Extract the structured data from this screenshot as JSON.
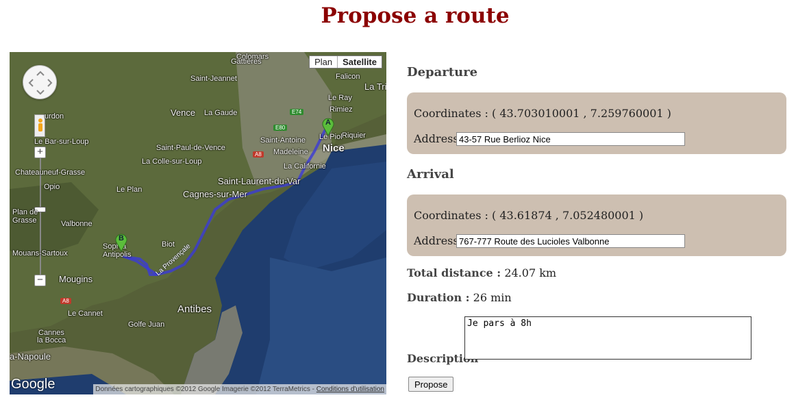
{
  "page": {
    "title": "Propose a route"
  },
  "map": {
    "type_buttons": {
      "plan": "Plan",
      "satellite": "Satellite",
      "selected": "Satellite"
    },
    "places": {
      "colomars": "Colomars",
      "gattieres": "Gattières",
      "saint_jeannet": "Saint-Jeannet",
      "falicon": "Falicon",
      "la_trinite": "La Tri",
      "le_ray": "Le Ray",
      "rimiez": "Rimiez",
      "tourrettes": "urdon",
      "vence": "Vence",
      "la_gaude": "La Gaude",
      "le_bar": "Le Bar-sur-Loup",
      "saint_paul": "Saint-Paul-de-Vence",
      "la_colle": "La Colle-sur-Loup",
      "saint_antoine": "Saint-Antoine",
      "madeleine": "Madeleine",
      "le_piol": "Le Piol",
      "riquier": "Riquier",
      "nice": "Nice",
      "la_californie": "La Californie",
      "chateauneuf": "Chateauneuf-Grasse",
      "opio": "Opio",
      "le_plan": "Le Plan",
      "saint_laurent": "Saint-Laurent-du-Var",
      "cagnes": "Cagnes-sur-Mer",
      "plan_de_grasse": "Plan de Grasse",
      "valbonne": "Valbonne",
      "biot": "Biot",
      "sophia": "Sophia Antipolis",
      "mouans": "Mouans-Sartoux",
      "mougins": "Mougins",
      "le_cannet": "Le Cannet",
      "antibes": "Antibes",
      "golfe_juan": "Golfe Juan",
      "cannes": "Cannes",
      "la_bocca": "la Bocca",
      "la_napoule": "a-Napoule",
      "route_name": "La Provençale"
    },
    "roads": {
      "a8": "A8",
      "e74": "E74",
      "e80": "E80"
    },
    "markers": {
      "start": "A",
      "end": "B"
    },
    "logo": "Google",
    "attribution": "Données cartographiques ©2012 Google Imagerie ©2012 TerraMetrics - ",
    "terms_link": "Conditions d'utilisation"
  },
  "departure": {
    "heading": "Departure",
    "coordinates": "Coordinates : ( 43.703010001 , 7.259760001 )",
    "address_label": "Address",
    "address_value": "43-57 Rue Berlioz Nice"
  },
  "arrival": {
    "heading": "Arrival",
    "coordinates": "Coordinates : ( 43.61874 , 7.052480001 )",
    "address_label": "Address",
    "address_value": "767-777 Route des Lucioles Valbonne"
  },
  "summary": {
    "distance_label": "Total distance :",
    "distance_value": "24.07 km",
    "duration_label": "Duration :",
    "duration_value": "26 min"
  },
  "description": {
    "label": "Description",
    "value": "Je pars à 8h"
  },
  "propose_button": "Propose",
  "colors": {
    "title": "#8b0000",
    "panel": "#cdbfb1",
    "route": "#3b3bd6",
    "marker": "#5bbd3b"
  }
}
